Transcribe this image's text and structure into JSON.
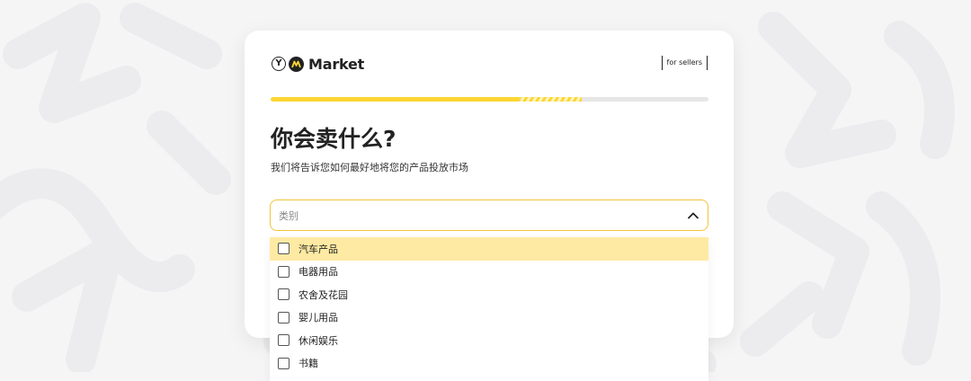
{
  "brand": {
    "ya_letter": "Y",
    "name": "Market"
  },
  "header": {
    "seller_link": "for sellers"
  },
  "progress": {
    "fraction": 0.71,
    "stripe_start": 0.57
  },
  "page": {
    "title": "你会卖什么?",
    "subtitle": "我们将告诉您如何最好地将您的产品投放市场"
  },
  "category_select": {
    "placeholder": "类别",
    "expanded": true,
    "options": [
      {
        "label": "汽车产品",
        "checked": false,
        "highlighted": true
      },
      {
        "label": "电器用品",
        "checked": false,
        "highlighted": false
      },
      {
        "label": "农舍及花园",
        "checked": false,
        "highlighted": false
      },
      {
        "label": "婴儿用品",
        "checked": false,
        "highlighted": false
      },
      {
        "label": "休闲娱乐",
        "checked": false,
        "highlighted": false
      },
      {
        "label": "书籍",
        "checked": false,
        "highlighted": false
      }
    ]
  },
  "colors": {
    "accent_yellow": "#fcd633",
    "highlight": "#ffeaa3",
    "focus_border": "#f2c43a",
    "background": "#f5f5f6"
  }
}
